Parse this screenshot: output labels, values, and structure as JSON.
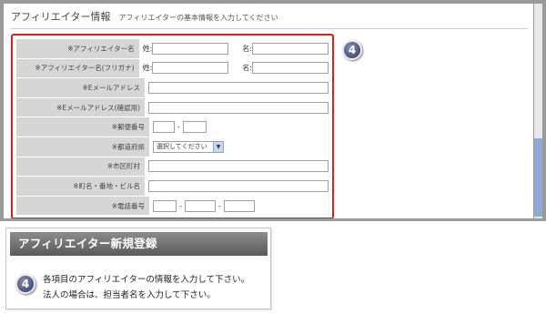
{
  "section": {
    "title": "アフィリエイター情報",
    "subtitle": "アフィリエイターの基本情報を入力してください"
  },
  "form": {
    "rows": [
      {
        "label": "※アフィリエイター名",
        "prefix_sei": "姓:",
        "prefix_mei": "名:"
      },
      {
        "label": "※アフィリエイター名(フリガナ)",
        "prefix_sei": "姓:",
        "prefix_mei": "名:"
      },
      {
        "label": "※Eメールアドレス"
      },
      {
        "label": "※Eメールアドレス(確認用)"
      },
      {
        "label": "※郵便番号",
        "separator": "-"
      },
      {
        "label": "※都道府県",
        "select_value": "選択してください"
      },
      {
        "label": "※市区町村"
      },
      {
        "label": "※町名・番地・ビル名"
      },
      {
        "label": "※電話番号",
        "separator": "-"
      }
    ]
  },
  "badge_number": "4",
  "caption": {
    "header": "アフィリエイター新規登録",
    "line1": "各項目のアフィリエイターの情報を入力して下さい。",
    "line2": "法人の場合は、担当者名を入力して下さい。"
  },
  "icons": {
    "select_arrow": "chevron-down-icon",
    "badge": "number-badge-icon"
  },
  "colors": {
    "highlight_border": "#e02020",
    "label_bg": "#d6d6d6",
    "header_bg": "#6e6e6e"
  }
}
